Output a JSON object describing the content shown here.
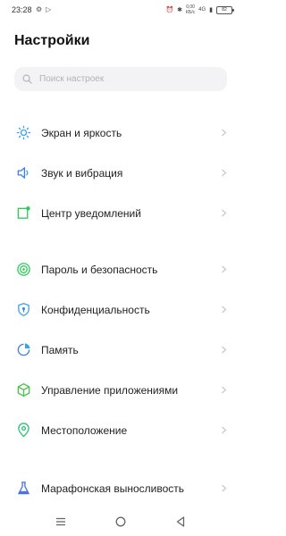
{
  "status_bar": {
    "time": "23:28",
    "speed_value": "0,00",
    "speed_unit": "КБ/с",
    "network": "4G",
    "battery": "82"
  },
  "page": {
    "title": "Настройки"
  },
  "search": {
    "placeholder": "Поиск настроек"
  },
  "groups": [
    {
      "items": [
        {
          "label": "Экран и яркость",
          "icon": "brightness-icon"
        },
        {
          "label": "Звук и вибрация",
          "icon": "speaker-icon"
        },
        {
          "label": "Центр уведомлений",
          "icon": "notification-center-icon"
        }
      ]
    },
    {
      "items": [
        {
          "label": "Пароль и безопасность",
          "icon": "security-icon"
        },
        {
          "label": "Конфиденциальность",
          "icon": "privacy-shield-icon"
        },
        {
          "label": "Память",
          "icon": "storage-pie-icon"
        },
        {
          "label": "Управление приложениями",
          "icon": "app-cube-icon"
        },
        {
          "label": "Местоположение",
          "icon": "location-pin-icon"
        }
      ]
    },
    {
      "items": [
        {
          "label": "Марафонская выносливость",
          "icon": "battery-flask-icon"
        }
      ]
    }
  ],
  "colors": {
    "brightness": "#3aa4e6",
    "speaker": "#3a7fe0",
    "notification": "#2ec95c",
    "security": "#2ec95c",
    "privacy": "#3aa4e6",
    "storage": "#3a7fe0",
    "apps": "#4cc24c",
    "location": "#2ec27a",
    "endurance": "#4a72e0"
  }
}
